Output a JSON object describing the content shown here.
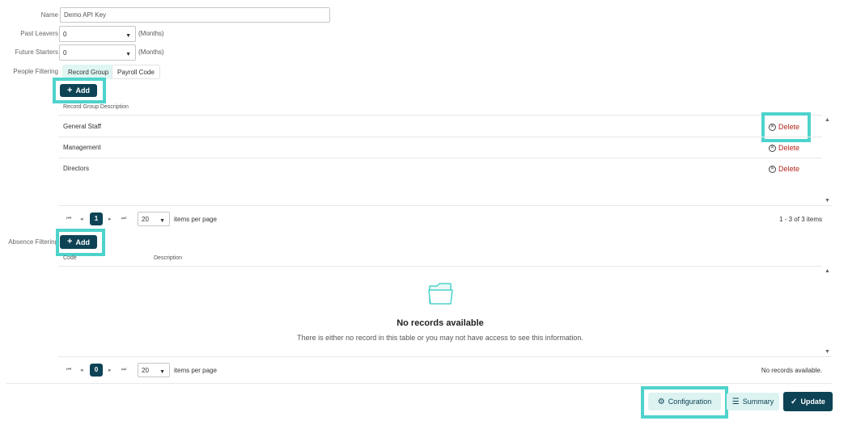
{
  "form": {
    "name_label": "Name",
    "name_value": "Demo API Key",
    "past_leavers_label": "Past Leavers",
    "past_leavers_value": "0",
    "future_starters_label": "Future Starters",
    "future_starters_value": "0",
    "months_unit": "(Months)",
    "people_filtering_label": "People Filtering",
    "absence_filtering_label": "Absence Filtering"
  },
  "tabs": [
    {
      "label": "Record Group",
      "active": true
    },
    {
      "label": "Payroll Code",
      "active": false
    }
  ],
  "record_groups": {
    "add_label": "Add",
    "column_header": "Record Group Description",
    "rows": [
      {
        "description": "General Staff",
        "action": "Delete"
      },
      {
        "description": "Management",
        "action": "Delete"
      },
      {
        "description": "Directors",
        "action": "Delete"
      }
    ],
    "pager": {
      "current_page": "1",
      "page_size": "20",
      "per_page_label": "items per page",
      "summary": "1 - 3 of 3 items"
    }
  },
  "absence": {
    "add_label": "Add",
    "columns": [
      "Code",
      "Description"
    ],
    "empty_title": "No records available",
    "empty_message": "There is either no record in this table or you may not have access to see this information.",
    "pager": {
      "current_page": "0",
      "page_size": "20",
      "per_page_label": "items per page",
      "summary": "No records available."
    }
  },
  "footer": {
    "configuration_label": "Configuration",
    "summary_label": "Summary",
    "update_label": "Update"
  },
  "colors": {
    "accent": "#0d4355",
    "highlight": "#4ed3cc",
    "danger": "#b3261e"
  }
}
